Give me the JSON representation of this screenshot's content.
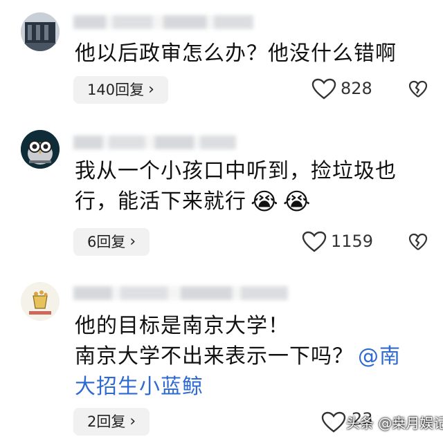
{
  "comments": [
    {
      "text_lines": [
        "他以后政审怎么办？他没什么错啊"
      ],
      "reply_label": "140回复",
      "likes": "828"
    },
    {
      "text_lines": [
        "我从一个小孩口中听到，捡垃圾也",
        "行，能活下来就行"
      ],
      "emoji": [
        "😭",
        "😭"
      ],
      "reply_label": "6回复",
      "likes": "1159"
    },
    {
      "text_lines": [
        "他的目标是南京大学！",
        "南京大学不出来表示一下吗？"
      ],
      "mention": "@南大招生小蓝鲸",
      "mention_line1": "@南",
      "mention_line2": "大招生小蓝鲸",
      "reply_label": "2回复",
      "likes": "23"
    }
  ],
  "icons": {
    "chevron": "chevron-right-icon",
    "like": "heart-outline-icon",
    "dislike": "broken-heart-icon"
  },
  "watermark": "头条 @桒月娱记",
  "colors": {
    "mention": "#2e6ad1",
    "reply_bg": "#f1f1f1"
  }
}
